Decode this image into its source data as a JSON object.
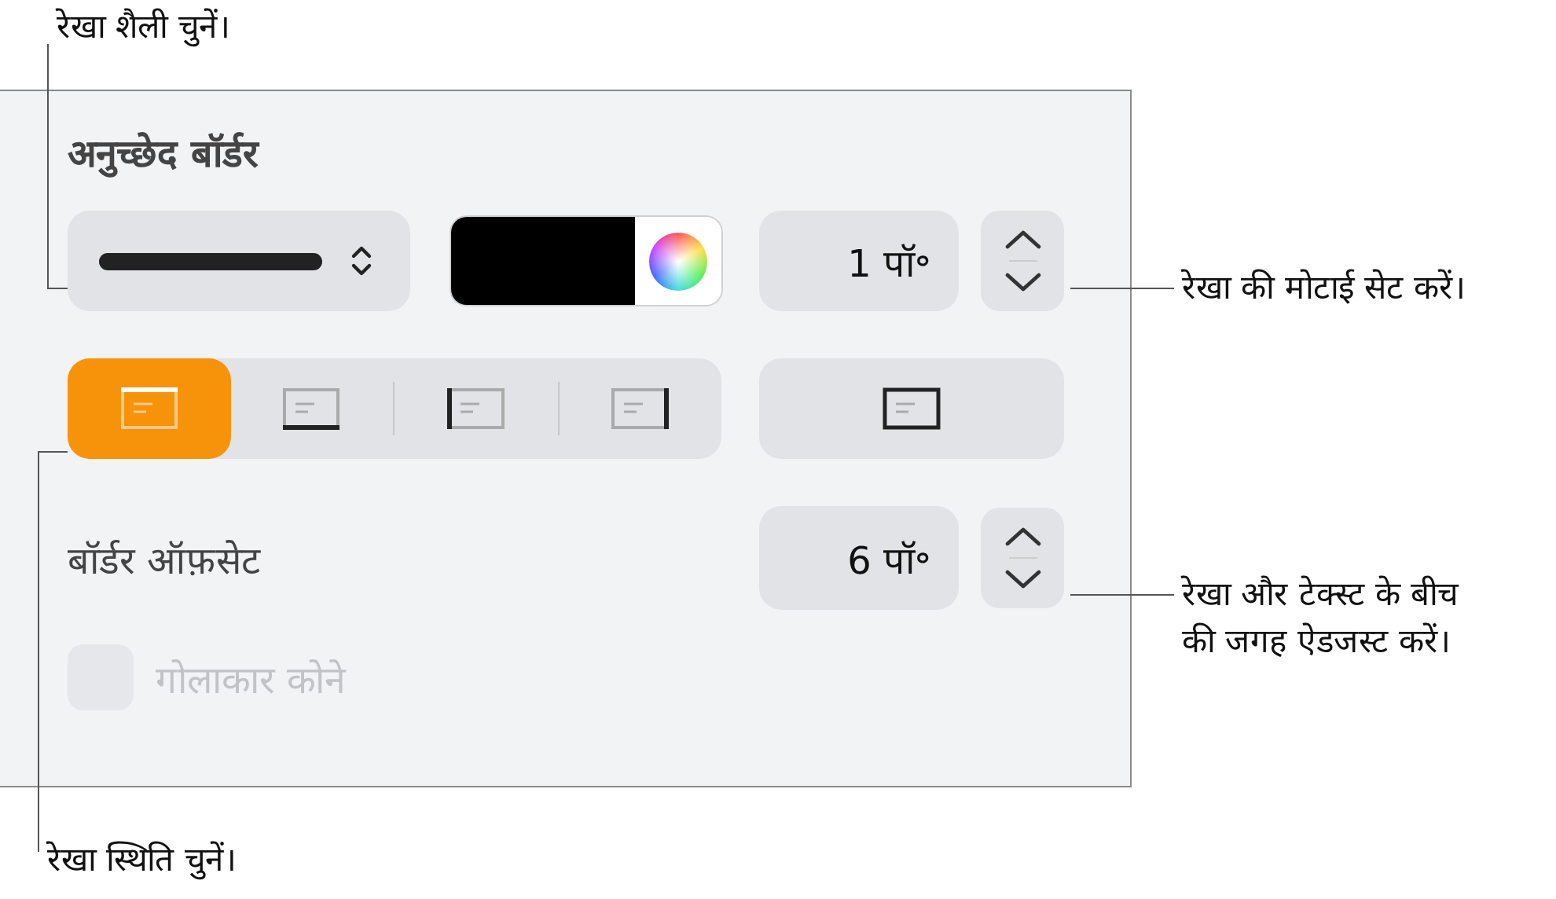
{
  "callouts": {
    "style": "रेखा शैली चुनें।",
    "width": "रेखा की मोटाई सेट करें।",
    "offset": "रेखा और टेक्स्ट के बीच की जगह ऐडजस्ट करें।",
    "position": "रेखा स्थिति चुनें।"
  },
  "panel": {
    "title": "अनुच्छेद बॉर्डर",
    "width_field": {
      "value": "1 पॉ॰"
    },
    "positions": [
      {
        "kind": "top",
        "selected": true
      },
      {
        "kind": "bottom",
        "selected": false
      },
      {
        "kind": "left",
        "selected": false
      },
      {
        "kind": "right",
        "selected": false
      }
    ],
    "offset_label": "बॉर्डर ऑफ़सेट",
    "offset_field": {
      "value": "6 पॉ॰"
    },
    "rounded_corners": {
      "label": "गोलाकार कोने",
      "checked": false,
      "disabled": true
    }
  }
}
